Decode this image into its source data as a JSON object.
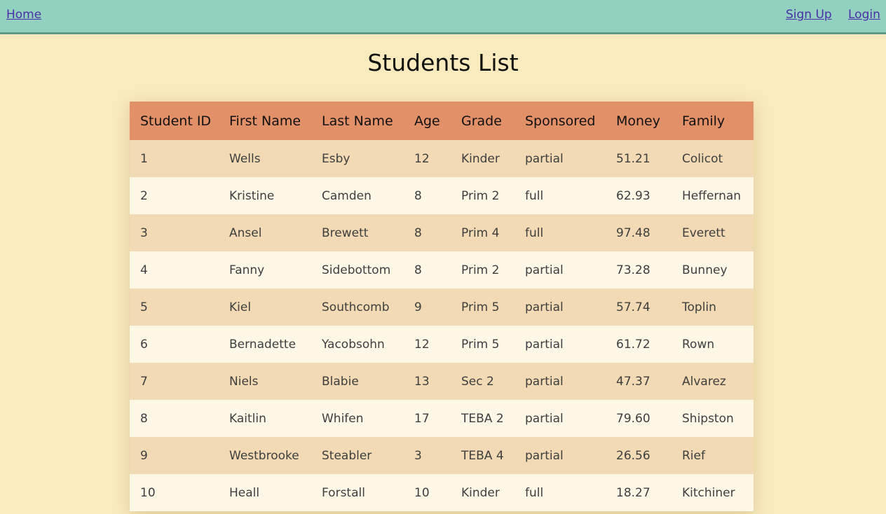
{
  "nav": {
    "home": "Home",
    "signup": "Sign Up",
    "login": "Login"
  },
  "page": {
    "title": "Students List"
  },
  "table": {
    "headers": [
      "Student ID",
      "First Name",
      "Last Name",
      "Age",
      "Grade",
      "Sponsored",
      "Money",
      "Family"
    ],
    "rows": [
      [
        "1",
        "Wells",
        "Esby",
        "12",
        "Kinder",
        "partial",
        "51.21",
        "Colicot"
      ],
      [
        "2",
        "Kristine",
        "Camden",
        "8",
        "Prim 2",
        "full",
        "62.93",
        "Heffernan"
      ],
      [
        "3",
        "Ansel",
        "Brewett",
        "8",
        "Prim 4",
        "full",
        "97.48",
        "Everett"
      ],
      [
        "4",
        "Fanny",
        "Sidebottom",
        "8",
        "Prim 2",
        "partial",
        "73.28",
        "Bunney"
      ],
      [
        "5",
        "Kiel",
        "Southcomb",
        "9",
        "Prim 5",
        "partial",
        "57.74",
        "Toplin"
      ],
      [
        "6",
        "Bernadette",
        "Yacobsohn",
        "12",
        "Prim 5",
        "partial",
        "61.72",
        "Rown"
      ],
      [
        "7",
        "Niels",
        "Blabie",
        "13",
        "Sec 2",
        "partial",
        "47.37",
        "Alvarez"
      ],
      [
        "8",
        "Kaitlin",
        "Whifen",
        "17",
        "TEBA 2",
        "partial",
        "79.60",
        "Shipston"
      ],
      [
        "9",
        "Westbrooke",
        "Steabler",
        "3",
        "TEBA 4",
        "partial",
        "26.56",
        "Rief"
      ],
      [
        "10",
        "Heall",
        "Forstall",
        "10",
        "Kinder",
        "full",
        "18.27",
        "Kitchiner"
      ]
    ]
  },
  "colors": {
    "page_background": "#f9ebbd",
    "navbar": "#92d1bf",
    "table_header": "#e29068",
    "row_odd": "#f1dab4",
    "row_even": "#fdf8e6",
    "link": "#4a2ea8"
  }
}
